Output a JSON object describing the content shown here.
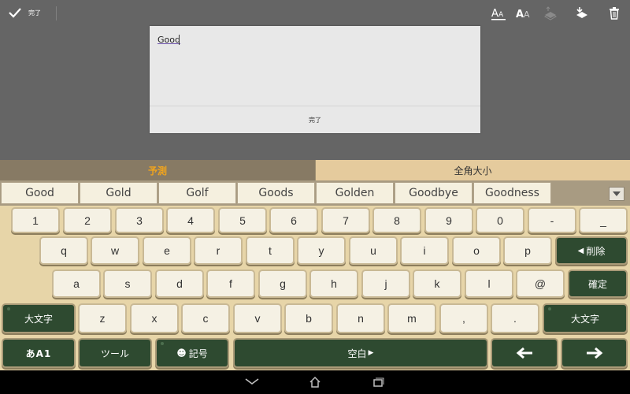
{
  "topbar": {
    "done_label": "完了",
    "icons": [
      "check-icon",
      "text-size-icon",
      "text-style-icon",
      "stack-up-icon",
      "download-tray-icon",
      "trash-icon"
    ]
  },
  "dialog": {
    "text": "Good",
    "done_label": "完了"
  },
  "keyboard": {
    "tabs": {
      "predict": "予測",
      "fullwidth": "全角大小"
    },
    "candidates": [
      "Good",
      "Gold",
      "Golf",
      "Goods",
      "Golden",
      "Goodbye",
      "Goodness"
    ],
    "row1": [
      "1",
      "2",
      "3",
      "4",
      "5",
      "6",
      "7",
      "8",
      "9",
      "0",
      "-",
      "_"
    ],
    "row2": [
      "q",
      "w",
      "e",
      "r",
      "t",
      "y",
      "u",
      "i",
      "o",
      "p"
    ],
    "row3": [
      "a",
      "s",
      "d",
      "f",
      "g",
      "h",
      "j",
      "k",
      "l",
      "@"
    ],
    "row4": [
      "z",
      "x",
      "c",
      "v",
      "b",
      "n",
      "m",
      ",",
      "."
    ],
    "delete_label": "削除",
    "confirm_label": "確定",
    "shift_left_label": "大文字",
    "shift_right_label": "大文字",
    "mode_label": "あA1",
    "tools_label": "ツール",
    "symbol_label": "記号",
    "space_label": "空白"
  },
  "colors": {
    "keyboard_bg": "#e7d5a8",
    "key_light": "#f5f1e4",
    "key_dark": "#2e4a30",
    "tab_active_text": "#f0a41d",
    "app_bg": "#656565"
  }
}
